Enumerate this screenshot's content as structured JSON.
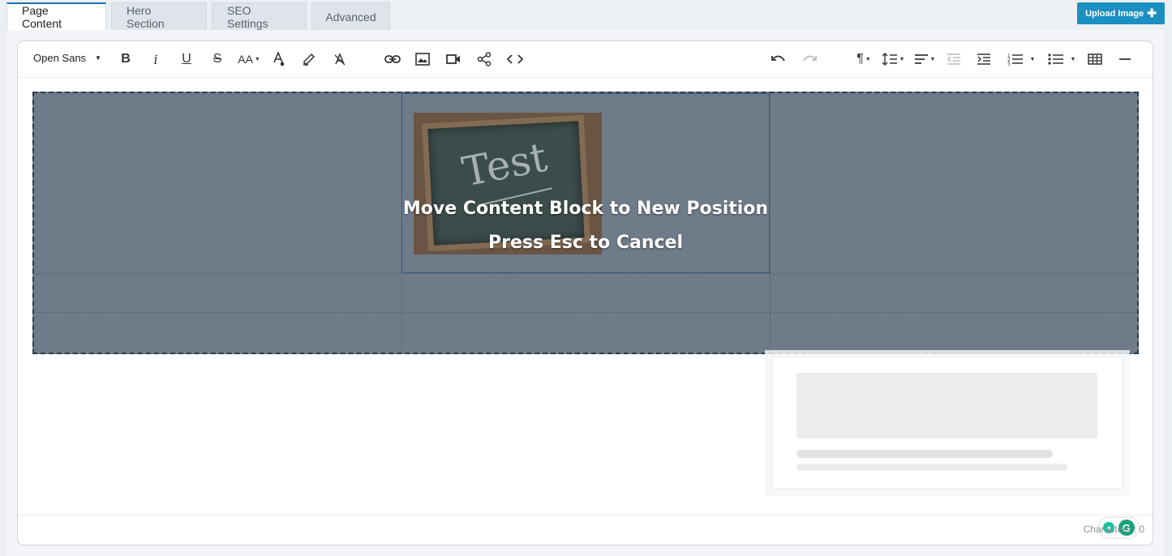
{
  "tabs": [
    {
      "label": "Page Content",
      "active": true
    },
    {
      "label": "Hero Section",
      "active": false
    },
    {
      "label": "SEO Settings",
      "active": false
    },
    {
      "label": "Advanced",
      "active": false
    }
  ],
  "upload_button": {
    "label": "Upload Image",
    "icon": "plus-icon"
  },
  "toolbar": {
    "font_family": "Open Sans",
    "font_size_label": "AA",
    "groups": {
      "text": [
        "bold-icon",
        "italic-icon",
        "underline-icon",
        "strikethrough-icon",
        "font-size-icon",
        "text-color-icon",
        "highlight-icon",
        "clear-format-icon"
      ],
      "insert": [
        "link-icon",
        "image-icon",
        "video-icon",
        "share-icon",
        "code-view-icon"
      ],
      "history": [
        "undo-icon",
        "redo-icon"
      ],
      "paragraph": [
        "paragraph-format-icon",
        "line-height-icon",
        "align-icon",
        "outdent-icon",
        "indent-icon",
        "ordered-list-icon",
        "unordered-list-icon",
        "table-icon",
        "horizontal-line-icon"
      ]
    }
  },
  "drag_overlay": {
    "message_line1": "Move Content Block to New Position",
    "message_line2": "Press Esc to Cancel",
    "image_text": "Test",
    "color": "#6f7b89"
  },
  "footer": {
    "characters_label": "Characters : 0"
  },
  "colors": {
    "accent": "#1b8fbf",
    "active_tab_border": "#1a73b8",
    "grammarly": "#15c39a"
  }
}
